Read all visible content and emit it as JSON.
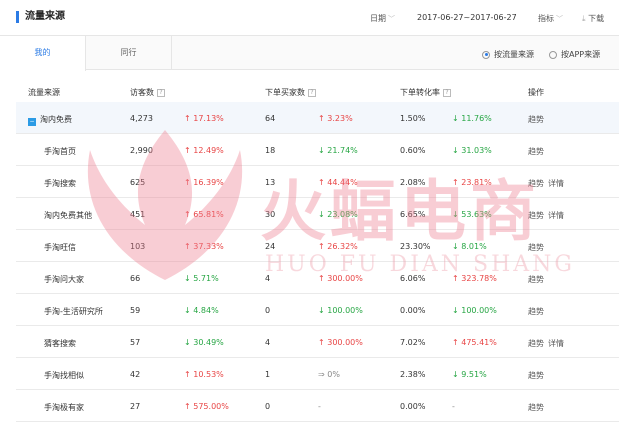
{
  "header": {
    "title": "流量来源",
    "date_label": "日期",
    "date_range": "2017-06-27~2017-06-27",
    "metric_label": "指标",
    "download_label": "下载"
  },
  "tabs": [
    {
      "label": "我的",
      "active": true
    },
    {
      "label": "同行",
      "active": false
    }
  ],
  "source_options": [
    {
      "label": "按流量来源",
      "selected": true
    },
    {
      "label": "按APP来源",
      "selected": false
    }
  ],
  "columns": {
    "source": "流量来源",
    "visitors": "访客数",
    "buyers": "下单买家数",
    "conversion": "下单转化率",
    "action": "操作"
  },
  "rows": [
    {
      "name": "淘内免费",
      "visitors": "4,273",
      "visitors_change": "17.13%",
      "visitors_dir": "up",
      "buyers": "64",
      "buyers_change": "3.23%",
      "buyers_dir": "up",
      "conv": "1.50%",
      "conv_change": "11.76%",
      "conv_dir": "down",
      "trend": "趋势",
      "detail": "",
      "parent": true
    },
    {
      "name": "手淘首页",
      "visitors": "2,990",
      "visitors_change": "12.49%",
      "visitors_dir": "up",
      "buyers": "18",
      "buyers_change": "21.74%",
      "buyers_dir": "down",
      "conv": "0.60%",
      "conv_change": "31.03%",
      "conv_dir": "down",
      "trend": "趋势",
      "detail": ""
    },
    {
      "name": "手淘搜索",
      "visitors": "625",
      "visitors_change": "16.39%",
      "visitors_dir": "up",
      "buyers": "13",
      "buyers_change": "44.44%",
      "buyers_dir": "up",
      "conv": "2.08%",
      "conv_change": "23.81%",
      "conv_dir": "up",
      "trend": "趋势",
      "detail": "详情"
    },
    {
      "name": "淘内免费其他",
      "visitors": "451",
      "visitors_change": "65.81%",
      "visitors_dir": "up",
      "buyers": "30",
      "buyers_change": "23.08%",
      "buyers_dir": "down",
      "conv": "6.65%",
      "conv_change": "53.63%",
      "conv_dir": "down",
      "trend": "趋势",
      "detail": "详情"
    },
    {
      "name": "手淘旺信",
      "visitors": "103",
      "visitors_change": "37.33%",
      "visitors_dir": "up",
      "buyers": "24",
      "buyers_change": "26.32%",
      "buyers_dir": "up",
      "conv": "23.30%",
      "conv_change": "8.01%",
      "conv_dir": "down",
      "trend": "趋势",
      "detail": ""
    },
    {
      "name": "手淘问大家",
      "visitors": "66",
      "visitors_change": "5.71%",
      "visitors_dir": "down",
      "buyers": "4",
      "buyers_change": "300.00%",
      "buyers_dir": "up",
      "conv": "6.06%",
      "conv_change": "323.78%",
      "conv_dir": "up",
      "trend": "趋势",
      "detail": ""
    },
    {
      "name": "手淘-生活研究所",
      "visitors": "59",
      "visitors_change": "4.84%",
      "visitors_dir": "down",
      "buyers": "0",
      "buyers_change": "100.00%",
      "buyers_dir": "down",
      "conv": "0.00%",
      "conv_change": "100.00%",
      "conv_dir": "down",
      "trend": "趋势",
      "detail": ""
    },
    {
      "name": "猜客搜索",
      "visitors": "57",
      "visitors_change": "30.49%",
      "visitors_dir": "down",
      "buyers": "4",
      "buyers_change": "300.00%",
      "buyers_dir": "up",
      "conv": "7.02%",
      "conv_change": "475.41%",
      "conv_dir": "up",
      "trend": "趋势",
      "detail": "详情"
    },
    {
      "name": "手淘找相似",
      "visitors": "42",
      "visitors_change": "10.53%",
      "visitors_dir": "up",
      "buyers": "1",
      "buyers_change": "0%",
      "buyers_dir": "flat",
      "conv": "2.38%",
      "conv_change": "9.51%",
      "conv_dir": "down",
      "trend": "趋势",
      "detail": ""
    },
    {
      "name": "手淘极有家",
      "visitors": "27",
      "visitors_change": "575.00%",
      "visitors_dir": "up",
      "buyers": "0",
      "buyers_change": "-",
      "buyers_dir": "none",
      "conv": "0.00%",
      "conv_change": "-",
      "conv_dir": "none",
      "trend": "趋势",
      "detail": ""
    }
  ],
  "watermark": {
    "text": "火蝠电商",
    "sub": "HUO FU DIAN SHANG"
  },
  "colors": {
    "accent": "#2b7be5",
    "up": "#e84545",
    "down": "#27a644",
    "watermark": "#ef7d8f"
  }
}
